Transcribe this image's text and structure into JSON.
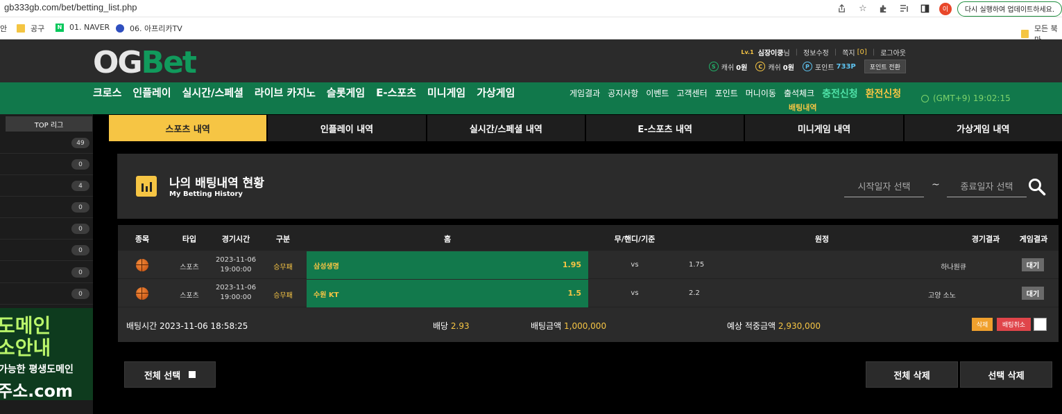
{
  "browser": {
    "url": "gb333gb.com/bet/betting_list.php",
    "profile_initial": "이",
    "relaunch_label": "다시 실행하여 업데이트하세요.",
    "bookmarks": [
      {
        "label": "안",
        "icon": "none"
      },
      {
        "label": "공구",
        "icon": "folder"
      },
      {
        "label": "01. NAVER",
        "icon": "naver"
      },
      {
        "label": "06. 아프리카TV",
        "icon": "afreeca"
      },
      {
        "label": "모든 북마",
        "icon": "folder"
      }
    ],
    "naver_letter": "N"
  },
  "header": {
    "logo_og": "OG",
    "logo_bet": "Bet",
    "level": "Lv.1",
    "username": "심장이쿵",
    "username_suffix": "님",
    "edit_info": "정보수정",
    "messages_label": "쪽지",
    "messages_count": "[0]",
    "logout": "로그아웃",
    "cash_label": "캐쉬",
    "cash_value": "0원",
    "casino_label": "캐쉬",
    "casino_value": "0원",
    "point_label": "포인트",
    "point_value": "733P",
    "point_convert": "포인트 전환"
  },
  "nav": {
    "main": [
      "크로스",
      "인플레이",
      "실시간/스페셜",
      "라이브 카지노",
      "슬롯게임",
      "E-스포츠",
      "미니게임",
      "가상게임"
    ],
    "sub": [
      "게임결과",
      "공지사항",
      "이벤트",
      "고객센터",
      "포인트",
      "머니이동",
      "출석체크"
    ],
    "charge": "충전신청",
    "exchange": "환전신청",
    "betting_history": "배팅내역",
    "clock": "(GMT+9)  19:02:15"
  },
  "sidebar": {
    "title": "TOP 리그",
    "counts": [
      "49",
      "0",
      "4",
      "0",
      "0",
      "0",
      "0",
      "0"
    ],
    "banner": [
      "도메인",
      "소안내",
      "가능한 평생도메인",
      "주소.com"
    ]
  },
  "tabs": [
    {
      "label": "스포츠 내역",
      "active": true
    },
    {
      "label": "인플레이 내역",
      "active": false
    },
    {
      "label": "실시간/스페셜 내역",
      "active": false
    },
    {
      "label": "E-스포츠 내역",
      "active": false
    },
    {
      "label": "미니게임 내역",
      "active": false
    },
    {
      "label": "가상게임 내역",
      "active": false
    }
  ],
  "panel": {
    "title": "나의 배팅내역 현황",
    "subtitle": "My Betting History",
    "start_placeholder": "시작일자 선택",
    "end_placeholder": "종료일자 선택",
    "tilde": "~"
  },
  "table": {
    "headers": [
      "종목",
      "타입",
      "경기시간",
      "구분",
      "홈",
      "무/핸디/기준",
      "원정",
      "경기결과",
      "게임결과"
    ],
    "rows": [
      {
        "type": "스포츠",
        "date": "2023-11-06",
        "time": "19:00:00",
        "kind": "승무패",
        "home": "삼성생명",
        "home_odds": "1.95",
        "vs": "vs",
        "away_odds": "1.75",
        "away": "하나원큐",
        "result": "대기"
      },
      {
        "type": "스포츠",
        "date": "2023-11-06",
        "time": "19:00:00",
        "kind": "승무패",
        "home": "수원 KT",
        "home_odds": "1.5",
        "vs": "vs",
        "away_odds": "2.2",
        "away": "고양 소노",
        "result": "대기"
      }
    ],
    "summary": {
      "bet_time": "배팅시간 2023-11-06 18:58:25",
      "odds_label": "배당",
      "odds_value": "2.93",
      "amount_label": "배팅금액",
      "amount_value": "1,000,000",
      "expected_label": "예상 적중금액",
      "expected_value": "2,930,000",
      "delete_label": "삭제",
      "cancel_label": "배팅취소"
    }
  },
  "bottom": {
    "select_all": "전체 선택",
    "delete_all": "전체 삭제",
    "delete_selected": "선택 삭제"
  }
}
